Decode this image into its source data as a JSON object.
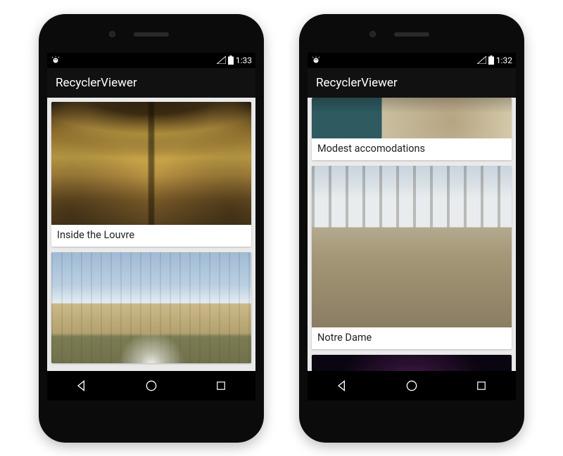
{
  "devices": [
    {
      "status": {
        "time": "1:33"
      },
      "app_title": "RecyclerViewer",
      "cards": [
        {
          "caption": "Inside the Louvre",
          "img": "louvre",
          "show_caption": true
        },
        {
          "caption": "",
          "img": "versailles",
          "show_caption": false
        }
      ]
    },
    {
      "status": {
        "time": "1:32"
      },
      "app_title": "RecyclerViewer",
      "cards": [
        {
          "caption": "Modest accomodations",
          "img": "bedroom",
          "show_caption": true
        },
        {
          "caption": "Notre Dame",
          "img": "notredame",
          "show_caption": true
        },
        {
          "caption": "",
          "img": "rose",
          "show_caption": false
        }
      ]
    }
  ]
}
